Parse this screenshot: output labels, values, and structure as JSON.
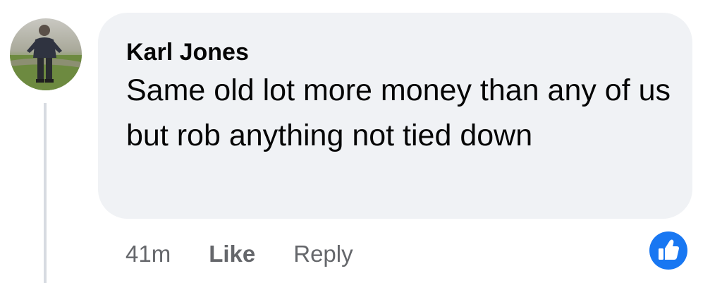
{
  "comment": {
    "author": "Karl Jones",
    "text": "Same old lot more money than any of us but rob anything not tied down",
    "timestamp": "41m",
    "like_label": "Like",
    "reply_label": "Reply",
    "reaction_icon": "like-reaction-icon"
  },
  "colors": {
    "bubble": "#f0f2f5",
    "text": "#050505",
    "secondary": "#65676b",
    "accent": "#1877f2"
  }
}
